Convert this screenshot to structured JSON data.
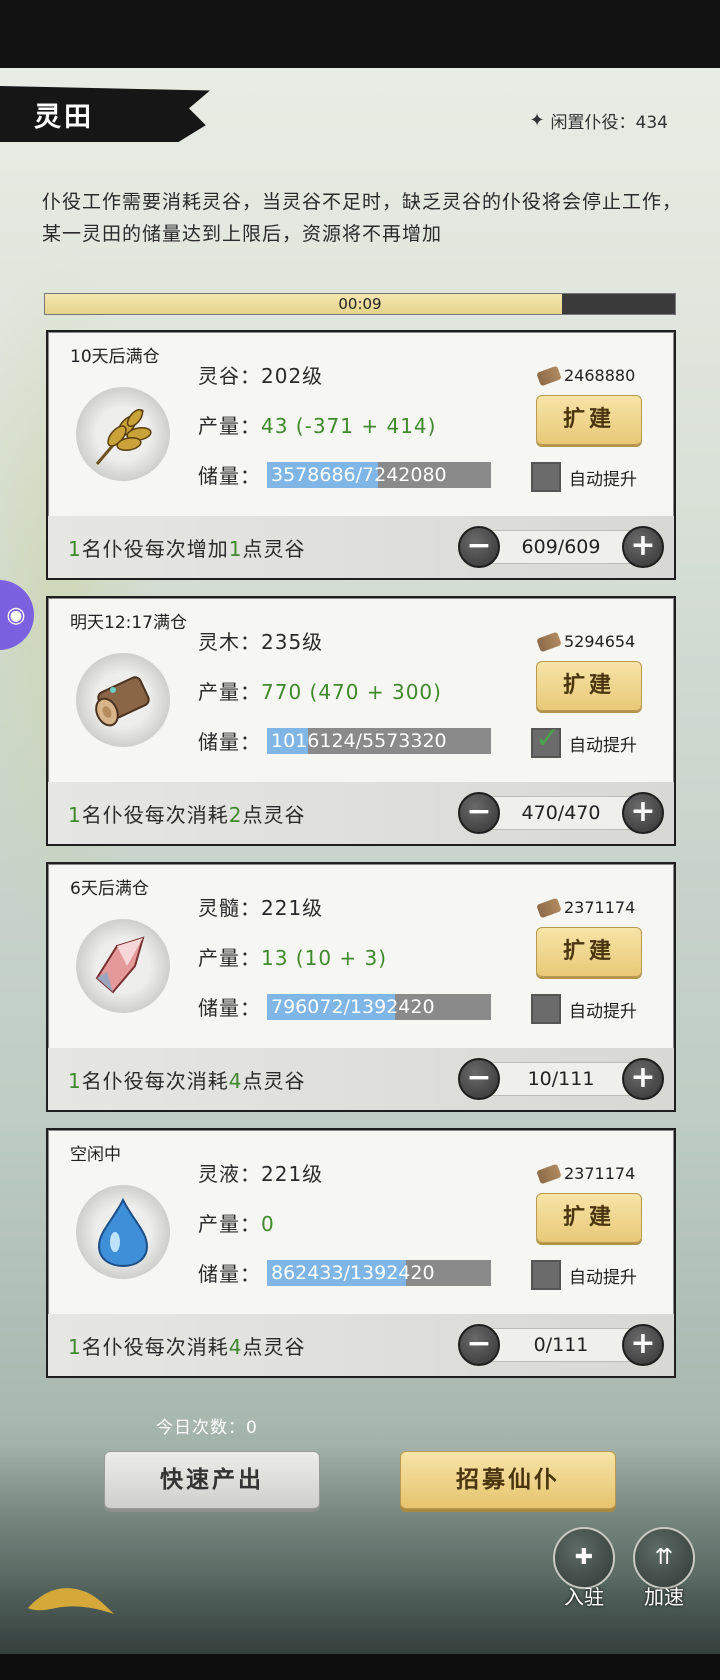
{
  "header": {
    "title": "灵田",
    "idle_servants_label": "闲置仆役：434"
  },
  "description": "仆役工作需要消耗灵谷，当灵谷不足时，缺乏灵谷的仆役将会停止工作，某一灵田的储量达到上限后，资源将不再增加",
  "timer": {
    "text": "00:09",
    "progress": 0.82
  },
  "fields": [
    {
      "status": "10天后满仓",
      "resource_icon": "wheat-icon",
      "level": "灵谷：202级",
      "output_label": "产量：",
      "output_value": "43 (-371 + 414)",
      "storage_label": "储量：",
      "storage": "3578686/7242080",
      "storage_fill": 0.494,
      "cost": "2468880",
      "expand_label": "扩建",
      "auto_label": "自动提升",
      "auto_checked": false,
      "foot_pre": "名仆役每次增加",
      "foot_n1": "1",
      "foot_n2": "1",
      "foot_post": "点灵谷",
      "stepper_value": "609/609"
    },
    {
      "status": "明天12:17满仓",
      "resource_icon": "wood-log-icon",
      "level": "灵木：235级",
      "output_label": "产量：",
      "output_value": "770 (470 + 300)",
      "storage_label": "储量：",
      "storage": "1016124/5573320",
      "storage_fill": 0.182,
      "cost": "5294654",
      "expand_label": "扩建",
      "auto_label": "自动提升",
      "auto_checked": true,
      "foot_pre": "名仆役每次消耗",
      "foot_n1": "1",
      "foot_n2": "2",
      "foot_post": "点灵谷",
      "stepper_value": "470/470"
    },
    {
      "status": "6天后满仓",
      "resource_icon": "crystal-icon",
      "level": "灵髓：221级",
      "output_label": "产量：",
      "output_value": "13 (10 + 3)",
      "storage_label": "储量：",
      "storage": "796072/1392420",
      "storage_fill": 0.572,
      "cost": "2371174",
      "expand_label": "扩建",
      "auto_label": "自动提升",
      "auto_checked": false,
      "foot_pre": "名仆役每次消耗",
      "foot_n1": "1",
      "foot_n2": "4",
      "foot_post": "点灵谷",
      "stepper_value": "10/111"
    },
    {
      "status": "空闲中",
      "resource_icon": "water-drop-icon",
      "level": "灵液：221级",
      "output_label": "产量：",
      "output_value": "0",
      "storage_label": "储量：",
      "storage": "862433/1392420",
      "storage_fill": 0.619,
      "cost": "2371174",
      "expand_label": "扩建",
      "auto_label": "自动提升",
      "auto_checked": false,
      "foot_pre": "名仆役每次消耗",
      "foot_n1": "1",
      "foot_n2": "4",
      "foot_post": "点灵谷",
      "stepper_value": "0/111"
    }
  ],
  "bottom": {
    "today_count": "今日次数：0",
    "fast_produce": "快速产出",
    "recruit": "招募仙仆",
    "station_label": "入驻",
    "speedup_label": "加速"
  }
}
